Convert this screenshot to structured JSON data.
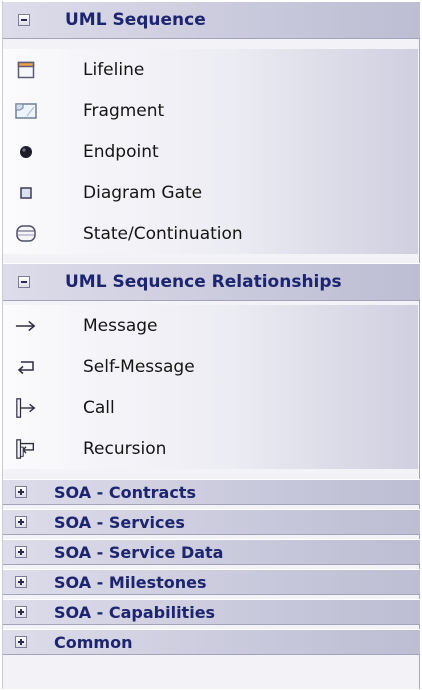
{
  "groups": [
    {
      "title": "UML Sequence",
      "expanded": true,
      "items": [
        {
          "label": "Lifeline",
          "icon": "lifeline-icon"
        },
        {
          "label": "Fragment",
          "icon": "fragment-icon"
        },
        {
          "label": "Endpoint",
          "icon": "endpoint-icon"
        },
        {
          "label": "Diagram Gate",
          "icon": "diagram-gate-icon"
        },
        {
          "label": "State/Continuation",
          "icon": "state-continuation-icon"
        }
      ]
    },
    {
      "title": "UML Sequence Relationships",
      "expanded": true,
      "items": [
        {
          "label": "Message",
          "icon": "message-arrow-icon"
        },
        {
          "label": "Self-Message",
          "icon": "self-message-icon"
        },
        {
          "label": "Call",
          "icon": "call-icon"
        },
        {
          "label": "Recursion",
          "icon": "recursion-icon"
        }
      ]
    },
    {
      "title": "SOA - Contracts",
      "expanded": false
    },
    {
      "title": "SOA - Services",
      "expanded": false
    },
    {
      "title": "SOA - Service Data",
      "expanded": false
    },
    {
      "title": "SOA - Milestones",
      "expanded": false
    },
    {
      "title": "SOA - Capabilities",
      "expanded": false
    },
    {
      "title": "Common",
      "expanded": false
    }
  ],
  "colors": {
    "header_text": "#1d2570",
    "header_bg": "#c9c9dc",
    "item_text": "#151515"
  }
}
